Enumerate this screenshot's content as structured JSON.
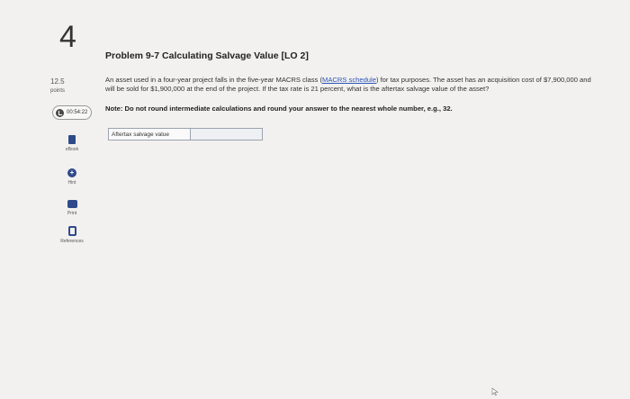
{
  "question": {
    "number": "4",
    "points_value": "12.5",
    "points_label": "points",
    "timer": "00:54:22"
  },
  "tools": {
    "ebook": "eBook",
    "hint": "Hint",
    "print": "Print",
    "references": "References"
  },
  "problem": {
    "title": "Problem 9-7 Calculating Salvage Value [LO 2]",
    "text_part1": "An asset used in a four-year project falls in the five-year MACRS class (",
    "link_text": "MACRS schedule",
    "text_part2": ") for tax purposes. The asset has an acquisition cost of $7,900,000 and will be sold for $1,900,000 at the end of the project. If the tax rate is 21 percent, what is the aftertax salvage value of the asset?",
    "note": "Note: Do not round intermediate calculations and round your answer to the nearest whole number, e.g., 32."
  },
  "answer": {
    "label": "Aftertax salvage value",
    "value": ""
  },
  "colors": {
    "accent": "#2f4a8a",
    "link": "#2e54b6",
    "background": "#f2f1ef"
  }
}
